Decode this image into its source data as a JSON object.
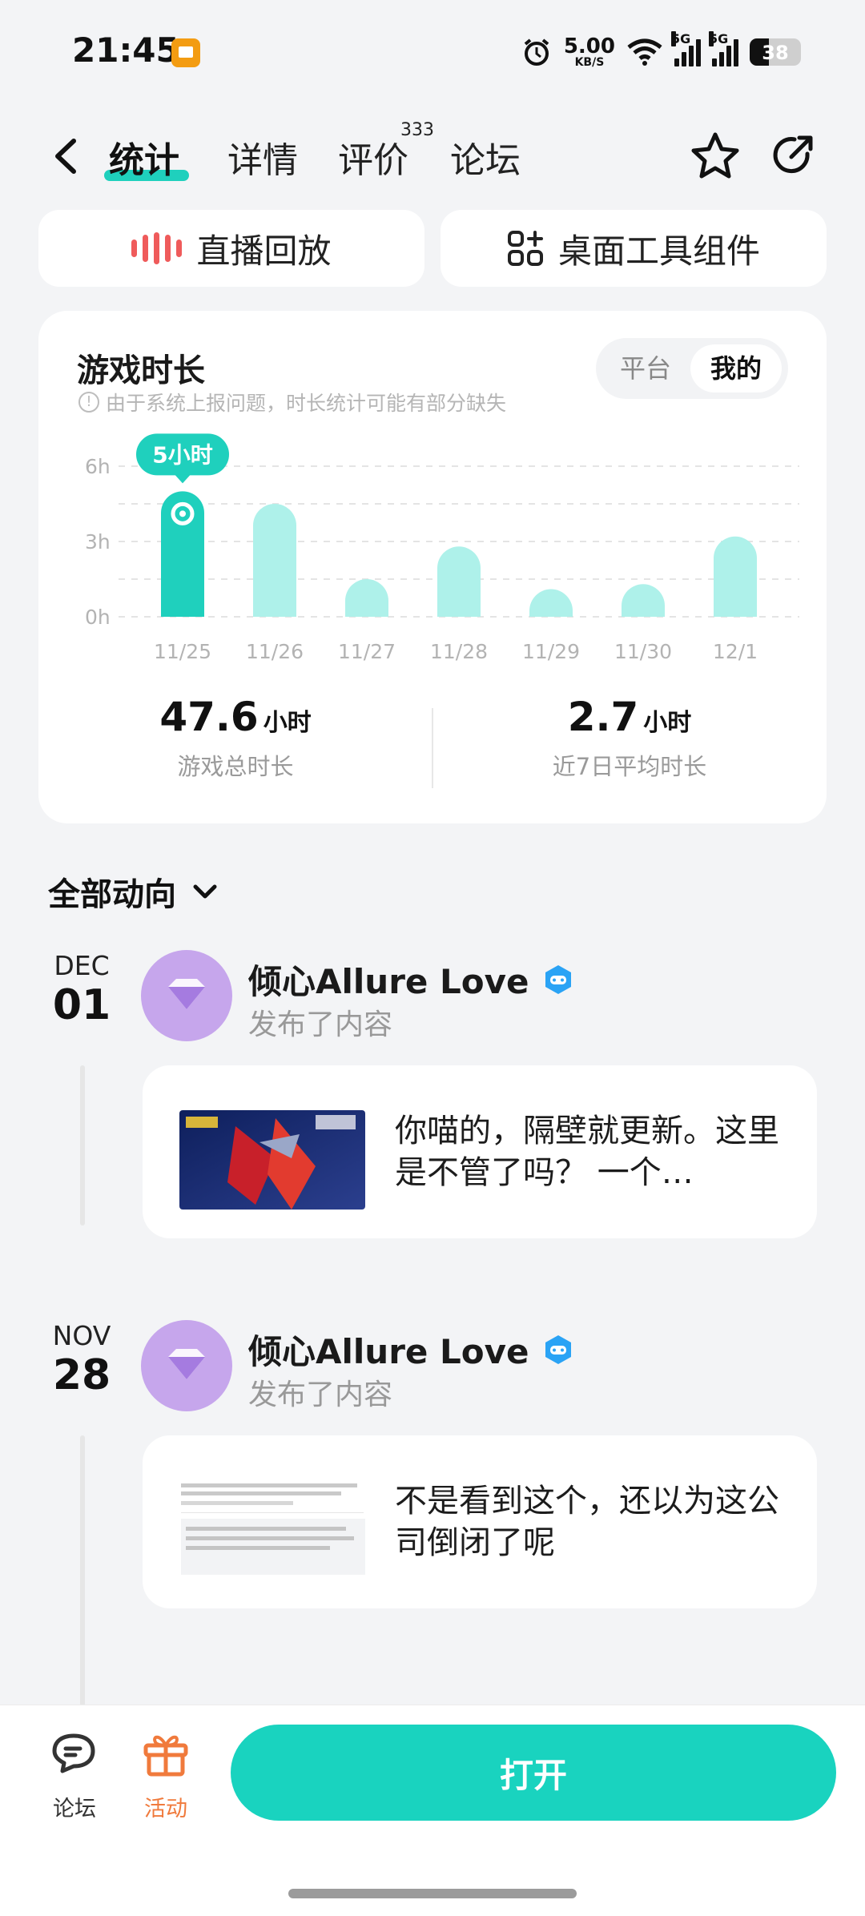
{
  "status_bar": {
    "time": "21:45",
    "speed_value": "5.00",
    "speed_unit": "KB/S",
    "net1": "5G",
    "net2": "5G",
    "battery": "38",
    "battery_level": 0.38
  },
  "nav": {
    "tabs": [
      {
        "label": "统计",
        "active": true
      },
      {
        "label": "详情",
        "active": false
      },
      {
        "label": "评价",
        "active": false,
        "badge": "333"
      },
      {
        "label": "论坛",
        "active": false
      }
    ]
  },
  "actions": {
    "live_replay": "直播回放",
    "desktop_widget": "桌面工具组件"
  },
  "stats_card": {
    "title": "游戏时长",
    "note": "由于系统上报问题，时长统计可能有部分缺失",
    "toggle": {
      "platform": "平台",
      "mine": "我的",
      "selected": "我的"
    },
    "total": {
      "value": "47.6",
      "unit": "小时",
      "label": "游戏总时长"
    },
    "average": {
      "value": "2.7",
      "unit": "小时",
      "label": "近7日平均时长"
    }
  },
  "chart_data": {
    "type": "bar",
    "categories": [
      "11/25",
      "11/26",
      "11/27",
      "11/28",
      "11/29",
      "11/30",
      "12/1"
    ],
    "values": [
      5,
      4.5,
      1.5,
      2.8,
      1.1,
      1.3,
      3.2
    ],
    "yticks": [
      "0h",
      "3h",
      "6h"
    ],
    "ylim": [
      0,
      6
    ],
    "highlight_index": 0,
    "highlight_label": "5小时",
    "colors": {
      "highlight": "#1fd0bd",
      "bar": "#aef1ea"
    },
    "grid": true
  },
  "feed": {
    "header": "全部动向",
    "posts": [
      {
        "month": "DEC",
        "day": "01",
        "user": "倾心Allure Love",
        "action": "发布了内容",
        "text": "你喵的，隔壁就更新。这里是不管了吗？ 一个…"
      },
      {
        "month": "NOV",
        "day": "28",
        "user": "倾心Allure Love",
        "action": "发布了内容",
        "text": "不是看到这个，还以为这公司倒闭了呢"
      }
    ]
  },
  "bottom_bar": {
    "forum": "论坛",
    "activity": "活动",
    "open": "打开"
  },
  "colors": {
    "accent": "#1fd0bd",
    "activity": "#f07a3c",
    "avatar": "#c6a6ec"
  }
}
